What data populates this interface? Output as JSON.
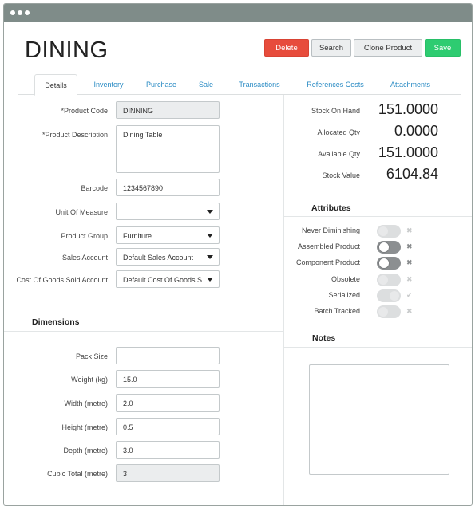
{
  "window": {
    "dots": 3
  },
  "header": {
    "title": "DINING",
    "buttons": {
      "delete": "Delete",
      "search": "Search",
      "clone": "Clone Product",
      "save": "Save"
    },
    "colors": {
      "delete": "#e74c3c",
      "save": "#2ecc71",
      "tab_link": "#2a8bc4"
    }
  },
  "tabs": [
    {
      "label": "Details",
      "active": true
    },
    {
      "label": "Inventory",
      "active": false
    },
    {
      "label": "Purchase",
      "active": false
    },
    {
      "label": "Sale",
      "active": false
    },
    {
      "label": "Transactions",
      "active": false
    },
    {
      "label": "References Costs",
      "active": false
    },
    {
      "label": "Attachments",
      "active": false
    }
  ],
  "details": {
    "product_code": {
      "label": "*Product Code",
      "value": "DINNING"
    },
    "product_description": {
      "label": "*Product Description",
      "value": "Dining Table"
    },
    "barcode": {
      "label": "Barcode",
      "value": "1234567890"
    },
    "unit_of_measure": {
      "label": "Unit Of Measure",
      "value": ""
    },
    "product_group": {
      "label": "Product Group",
      "value": "Furniture"
    },
    "sales_account": {
      "label": "Sales Account",
      "value": "Default Sales Account"
    },
    "cogs_account": {
      "label": "Cost Of Goods Sold Account",
      "value": "Default Cost Of Goods S"
    }
  },
  "dimensions": {
    "title": "Dimensions",
    "pack_size": {
      "label": "Pack Size",
      "value": ""
    },
    "weight": {
      "label": "Weight (kg)",
      "value": "15.0"
    },
    "width": {
      "label": "Width (metre)",
      "value": "2.0"
    },
    "height": {
      "label": "Height (metre)",
      "value": "0.5"
    },
    "depth": {
      "label": "Depth (metre)",
      "value": "3.0"
    },
    "cubic_total": {
      "label": "Cubic Total (metre)",
      "value": "3"
    }
  },
  "stock": {
    "on_hand": {
      "label": "Stock On Hand",
      "value": "151.0000"
    },
    "allocated": {
      "label": "Allocated Qty",
      "value": "0.0000"
    },
    "available": {
      "label": "Available Qty",
      "value": "151.0000"
    },
    "value": {
      "label": "Stock Value",
      "value": "6104.84"
    }
  },
  "attributes": {
    "title": "Attributes",
    "items": [
      {
        "label": "Never Diminishing",
        "on": false,
        "enabled": false,
        "mark": "✖"
      },
      {
        "label": "Assembled Product",
        "on": false,
        "enabled": true,
        "mark": "✖"
      },
      {
        "label": "Component Product",
        "on": false,
        "enabled": true,
        "mark": "✖"
      },
      {
        "label": "Obsolete",
        "on": false,
        "enabled": false,
        "mark": "✖"
      },
      {
        "label": "Serialized",
        "on": true,
        "enabled": false,
        "mark": "✔"
      },
      {
        "label": "Batch Tracked",
        "on": false,
        "enabled": false,
        "mark": "✖"
      }
    ]
  },
  "notes": {
    "title": "Notes",
    "value": ""
  }
}
